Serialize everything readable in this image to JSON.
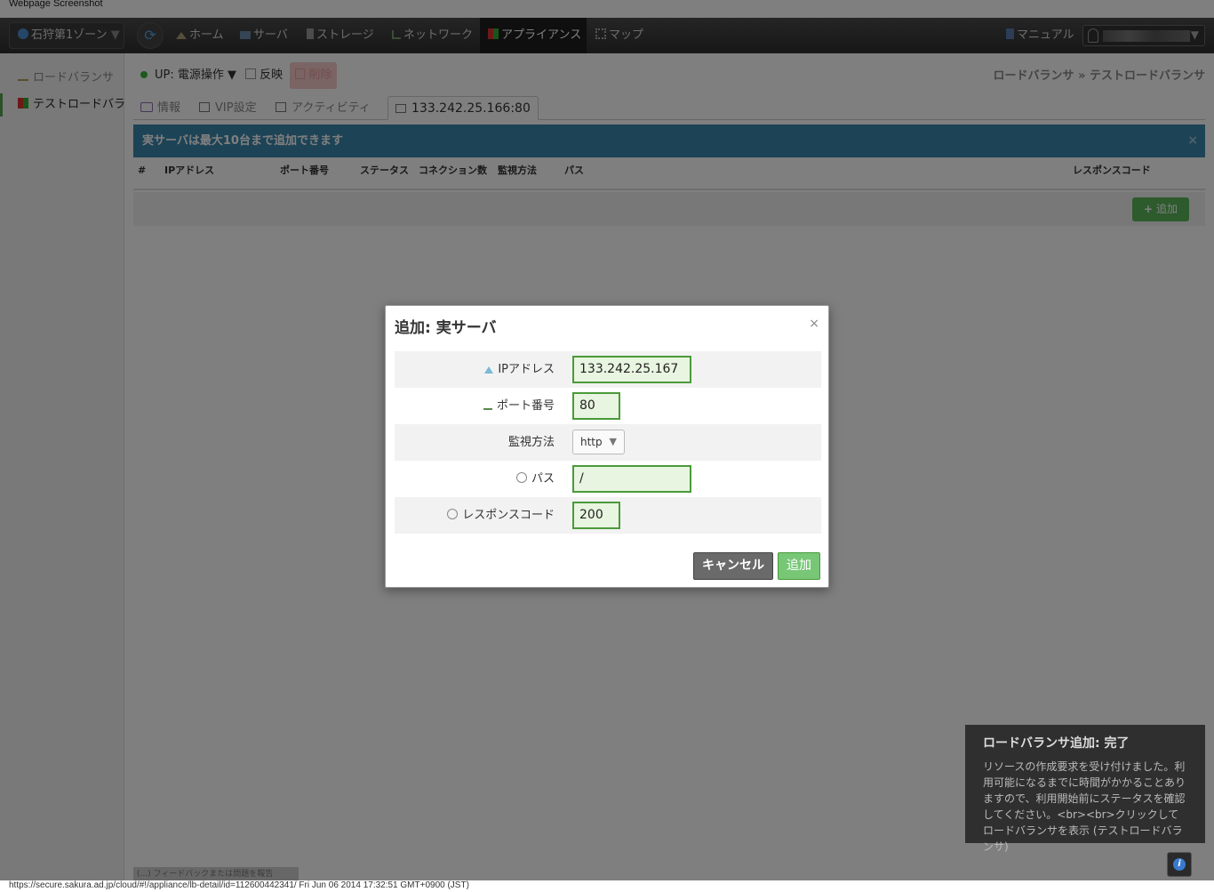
{
  "caption": "Webpage Screenshot",
  "nav": {
    "zone": "石狩第1ゾーン",
    "home": "ホーム",
    "server": "サーバ",
    "storage": "ストレージ",
    "network": "ネットワーク",
    "appliance": "アプライアンス",
    "map": "マップ",
    "manual": "マニュアル"
  },
  "sidebar": {
    "items": [
      {
        "label": "ロードバランサ"
      },
      {
        "label": "テストロードバランサ"
      }
    ]
  },
  "status": {
    "power": "UP: 電源操作",
    "apply": "反映",
    "delete": "削除"
  },
  "breadcrumb": "ロードバランサ » テストロードバランサ",
  "tabs": [
    {
      "label": "情報"
    },
    {
      "label": "VIP設定"
    },
    {
      "label": "アクティビティ"
    },
    {
      "label": "133.242.25.166:80"
    }
  ],
  "alert": {
    "text": "実サーバは最大10台まで追加できます",
    "close": "×"
  },
  "table": {
    "headers": [
      "#",
      "IPアドレス",
      "ポート番号",
      "ステータス",
      "コネクション数",
      "監視方法",
      "パス",
      "レスポンスコード"
    ],
    "add_label": "追加"
  },
  "modal": {
    "title": "追加: 実サーバ",
    "close": "×",
    "fields": {
      "ip_label": "IPアドレス",
      "ip_value": "133.242.25.167",
      "port_label": "ポート番号",
      "port_value": "80",
      "method_label": "監視方法",
      "method_value": "http",
      "path_label": "パス",
      "path_value": "/",
      "code_label": "レスポンスコード",
      "code_value": "200"
    },
    "cancel": "キャンセル",
    "submit": "追加"
  },
  "toast": {
    "title": "ロードバランサ追加: 完了",
    "body": "リソースの作成要求を受け付けました。利用可能になるまでに時間がかかることありますので、利用開始前にステータスを確認してください。<br><br>クリックしてロードバランサを表示 (テストロードバランサ)"
  },
  "help_icon": "i",
  "url_status": "https://secure.sakura.ad.jp/cloud/#!/appliance/lb-detail/id=112600442341/ Fri Jun 06 2014 17:32:51 GMT+0900 (JST)",
  "footer_fragment": "(...) フィードバックまたは問題を報告",
  "colors": {
    "accent_green": "#5bb75b",
    "info_blue": "#3a87ad",
    "nav_dark": "#2f2f2f"
  }
}
